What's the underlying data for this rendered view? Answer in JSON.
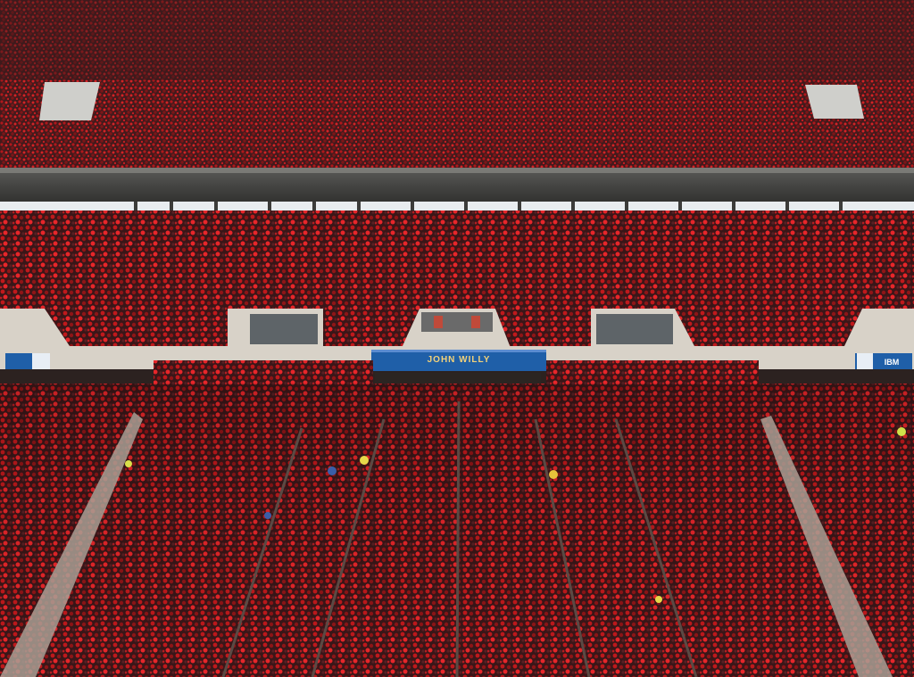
{
  "scene": {
    "colors": {
      "crowd_dark": "#3a1618",
      "crowd_red": "#c0191c",
      "crowd_bright": "#e8262a",
      "concrete": "#d8d2c8",
      "roof_band": "#4a4a48",
      "sign_blue": "#1f5fa8",
      "sky": "#e8ecef"
    }
  },
  "signage": {
    "center_banner": "JOHN WILLY",
    "left_ribbon": "",
    "right_ribbon": "IBM"
  }
}
